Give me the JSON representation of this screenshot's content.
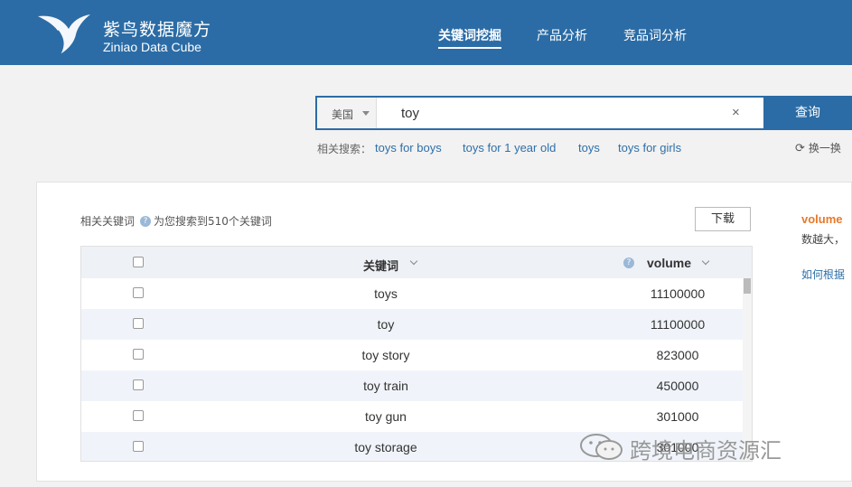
{
  "header": {
    "brand_cn": "紫鸟数据魔方",
    "brand_en": "Ziniao Data Cube",
    "nav": [
      "关键词挖掘",
      "产品分析",
      "竞品词分析"
    ],
    "active_nav": "关键词挖掘"
  },
  "search": {
    "country": "美国",
    "value": "toy",
    "button": "查询",
    "related_label": "相关搜索：",
    "related": [
      "toys for boys",
      "toys for 1 year old",
      "toys",
      "toys for girls"
    ],
    "refresh": "换一换"
  },
  "results": {
    "label": "相关关键词",
    "summary": "为您搜索到510个关键词",
    "download": "下载",
    "columns": {
      "keyword": "关键词",
      "volume": "volume"
    },
    "rows": [
      {
        "keyword": "toys",
        "volume": "11100000"
      },
      {
        "keyword": "toy",
        "volume": "11100000"
      },
      {
        "keyword": "toy story",
        "volume": "823000"
      },
      {
        "keyword": "toy train",
        "volume": "450000"
      },
      {
        "keyword": "toy gun",
        "volume": "301000"
      },
      {
        "keyword": "toy storage",
        "volume": "301000"
      }
    ]
  },
  "side": {
    "title": "volume",
    "desc": "数越大，",
    "link": "如何根据"
  },
  "watermark": {
    "text": "跨境电商资源汇"
  },
  "colors": {
    "brand": "#2b6ca6",
    "accent": "#e8792a",
    "link": "#2f6fa8"
  }
}
